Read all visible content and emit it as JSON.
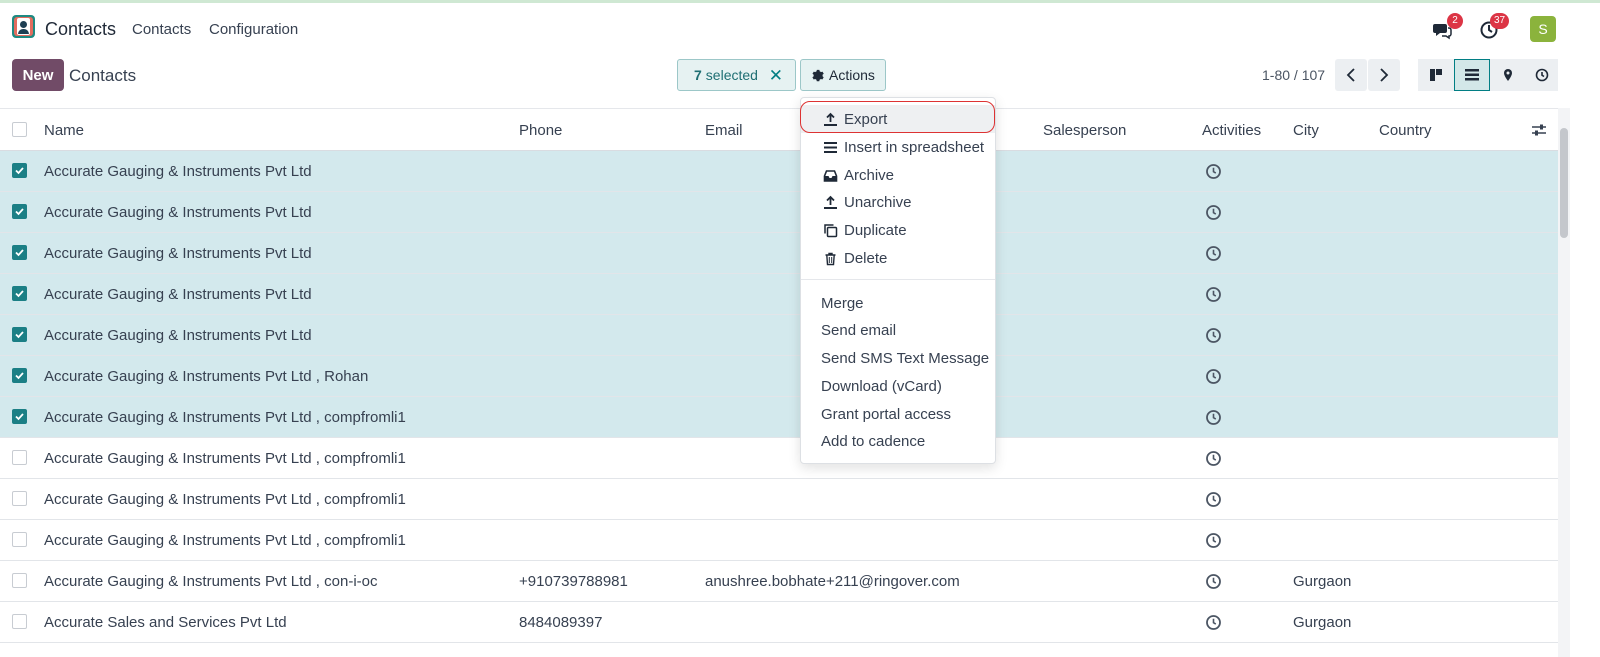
{
  "navbar": {
    "app_name": "Contacts",
    "menus": [
      "Contacts",
      "Configuration"
    ],
    "chat_badge": "2",
    "activity_badge": "37",
    "avatar_letter": "S"
  },
  "control": {
    "new_label": "New",
    "breadcrumb": "Contacts",
    "selected_count": "7",
    "selected_label": "selected",
    "actions_label": "Actions",
    "pager": "1-80 / 107"
  },
  "table": {
    "headers": {
      "name": "Name",
      "phone": "Phone",
      "email": "Email",
      "salesperson": "Salesperson",
      "activities": "Activities",
      "city": "City",
      "country": "Country"
    },
    "rows": [
      {
        "name": "Accurate Gauging & Instruments Pvt Ltd",
        "phone": "",
        "email": "",
        "city": "",
        "selected": true
      },
      {
        "name": "Accurate Gauging & Instruments Pvt Ltd",
        "phone": "",
        "email": "",
        "city": "",
        "selected": true
      },
      {
        "name": "Accurate Gauging & Instruments Pvt Ltd",
        "phone": "",
        "email": "",
        "city": "",
        "selected": true
      },
      {
        "name": "Accurate Gauging & Instruments Pvt Ltd",
        "phone": "",
        "email": "",
        "city": "",
        "selected": true
      },
      {
        "name": "Accurate Gauging & Instruments Pvt Ltd",
        "phone": "",
        "email": "",
        "city": "",
        "selected": true
      },
      {
        "name": "Accurate Gauging & Instruments Pvt Ltd , Rohan",
        "phone": "",
        "email": "",
        "city": "",
        "selected": true
      },
      {
        "name": "Accurate Gauging & Instruments Pvt Ltd , compfromli1",
        "phone": "",
        "email": "",
        "city": "",
        "selected": true
      },
      {
        "name": "Accurate Gauging & Instruments Pvt Ltd , compfromli1",
        "phone": "",
        "email": "",
        "city": "",
        "selected": false
      },
      {
        "name": "Accurate Gauging & Instruments Pvt Ltd , compfromli1",
        "phone": "",
        "email": "",
        "city": "",
        "selected": false
      },
      {
        "name": "Accurate Gauging & Instruments Pvt Ltd , compfromli1",
        "phone": "",
        "email": "",
        "city": "",
        "selected": false
      },
      {
        "name": "Accurate Gauging & Instruments Pvt Ltd , con-i-oc",
        "phone": "+910739788981",
        "email": "anushree.bobhate+211@ringover.com",
        "city": "Gurgaon",
        "selected": false
      },
      {
        "name": "Accurate Sales and Services Pvt Ltd",
        "phone": "8484089397",
        "email": "",
        "city": "Gurgaon",
        "selected": false
      }
    ]
  },
  "dropdown": {
    "icon_items": [
      {
        "label": "Export",
        "icon": "upload-icon"
      },
      {
        "label": "Insert in spreadsheet",
        "icon": "list-icon"
      },
      {
        "label": "Archive",
        "icon": "inbox-icon"
      },
      {
        "label": "Unarchive",
        "icon": "upload-icon"
      },
      {
        "label": "Duplicate",
        "icon": "copy-icon"
      },
      {
        "label": "Delete",
        "icon": "trash-icon"
      }
    ],
    "plain_items": [
      "Merge",
      "Send email",
      "Send SMS Text Message",
      "Download (vCard)",
      "Grant portal access",
      "Add to cadence"
    ]
  },
  "colors": {
    "brand": "#714b67",
    "accent": "#017e84",
    "selected_row": "#d3e9ed",
    "badge": "#dc3545"
  }
}
